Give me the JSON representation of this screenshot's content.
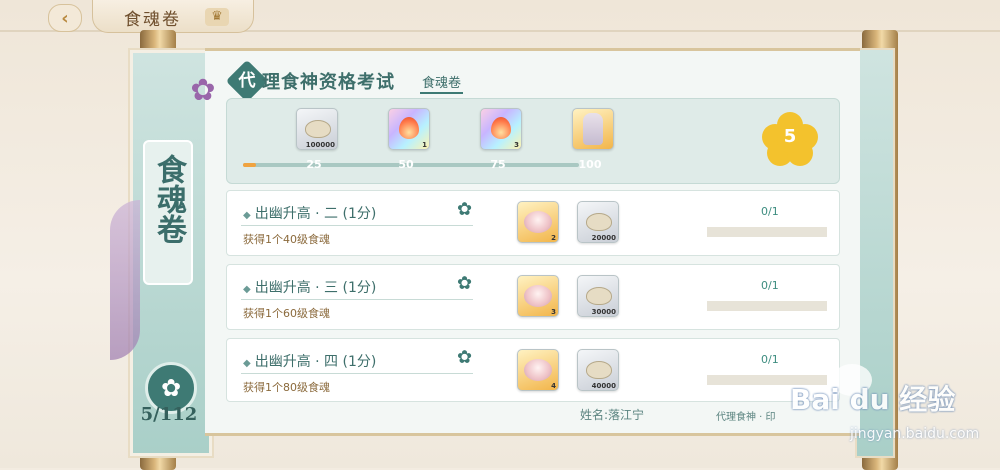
{
  "header": {
    "back_icon": "chevron-left-icon",
    "title": "食魂卷",
    "home_icon": "crown-icon"
  },
  "scroll": {
    "vertical_title": "食魂卷",
    "counter": "5/112",
    "badge_icon": "flower-icon"
  },
  "exam": {
    "title_char": "代",
    "title_rest": "理食神资格考试",
    "subtitle": "食魂卷",
    "star_count": "5",
    "progress": {
      "fraction": 0.04,
      "milestones": [
        {
          "value": "25",
          "reward": "dumpling",
          "qty": "100000"
        },
        {
          "value": "50",
          "reward": "flame",
          "qty": "1"
        },
        {
          "value": "75",
          "reward": "flame",
          "qty": "3"
        },
        {
          "value": "100",
          "reward": "character",
          "qty": ""
        }
      ]
    }
  },
  "tasks": [
    {
      "name": "出幽升高 · 二 (1分)",
      "desc": "获得1个40级食魂",
      "reward1_qty": "2",
      "reward2_qty": "20000",
      "progress": "0/1",
      "fraction": 0
    },
    {
      "name": "出幽升高 · 三 (1分)",
      "desc": "获得1个60级食魂",
      "reward1_qty": "3",
      "reward2_qty": "30000",
      "progress": "0/1",
      "fraction": 0
    },
    {
      "name": "出幽升高 · 四 (1分)",
      "desc": "获得1个80级食魂",
      "reward1_qty": "4",
      "reward2_qty": "40000",
      "progress": "0/1",
      "fraction": 0
    }
  ],
  "footer": {
    "name": "姓名:落江宁",
    "role": "代理食神 · 印"
  },
  "watermark": {
    "logo": "Bai du 经验",
    "url": "jingyan.baidu.com"
  },
  "colors": {
    "accent": "#3e7a74",
    "gold": "#f3c22d",
    "progress": "#f0a340"
  }
}
